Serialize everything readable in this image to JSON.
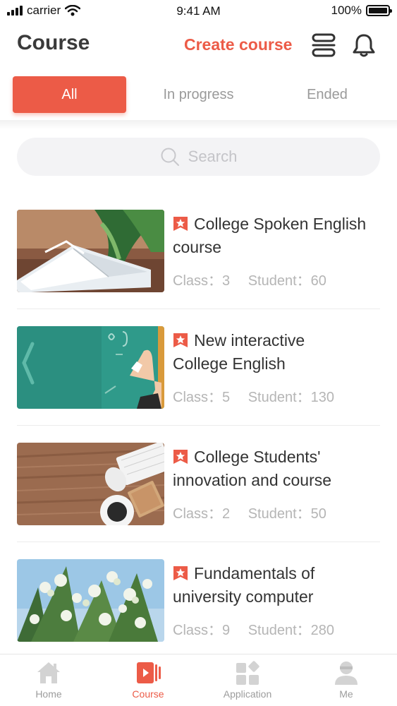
{
  "status_bar": {
    "carrier": "carrier",
    "time": "9:41 AM",
    "battery": "100%"
  },
  "header": {
    "title": "Course",
    "create_label": "Create course",
    "menu_icon": "list-icon",
    "bell_icon": "bell-icon"
  },
  "tabs": [
    {
      "label": "All",
      "active": true
    },
    {
      "label": "In progress",
      "active": false
    },
    {
      "label": "Ended",
      "active": false
    }
  ],
  "search": {
    "placeholder": "Search"
  },
  "courses": [
    {
      "name_line1": "College Spoken English",
      "name_line2": "course",
      "class_label": "Class：",
      "class_value": "3",
      "student_label": "Student：",
      "student_value": "60",
      "thumb": "open-book-plant"
    },
    {
      "name_line1": "New interactive",
      "name_line2": "College English",
      "class_label": "Class：",
      "class_value": "5",
      "student_label": "Student：",
      "student_value": "130",
      "thumb": "chalkboard-hand"
    },
    {
      "name_line1": "College Students'",
      "name_line2": "innovation and course",
      "class_label": "Class：",
      "class_value": "2",
      "student_label": "Student：",
      "student_value": "50",
      "thumb": "desk-keyboard"
    },
    {
      "name_line1": "Fundamentals of",
      "name_line2": "university computer",
      "class_label": "Class：",
      "class_value": "9",
      "student_label": "Student：",
      "student_value": "280",
      "thumb": "blossom-sky"
    }
  ],
  "bottom_nav": [
    {
      "label": "Home",
      "icon": "home-icon",
      "active": false
    },
    {
      "label": "Course",
      "icon": "course-icon",
      "active": true
    },
    {
      "label": "Application",
      "icon": "grid-icon",
      "active": false
    },
    {
      "label": "Me",
      "icon": "person-icon",
      "active": false
    }
  ],
  "colors": {
    "accent": "#ec5b47",
    "muted": "#9c9c9c",
    "icon_gray": "#cfcfcf"
  }
}
